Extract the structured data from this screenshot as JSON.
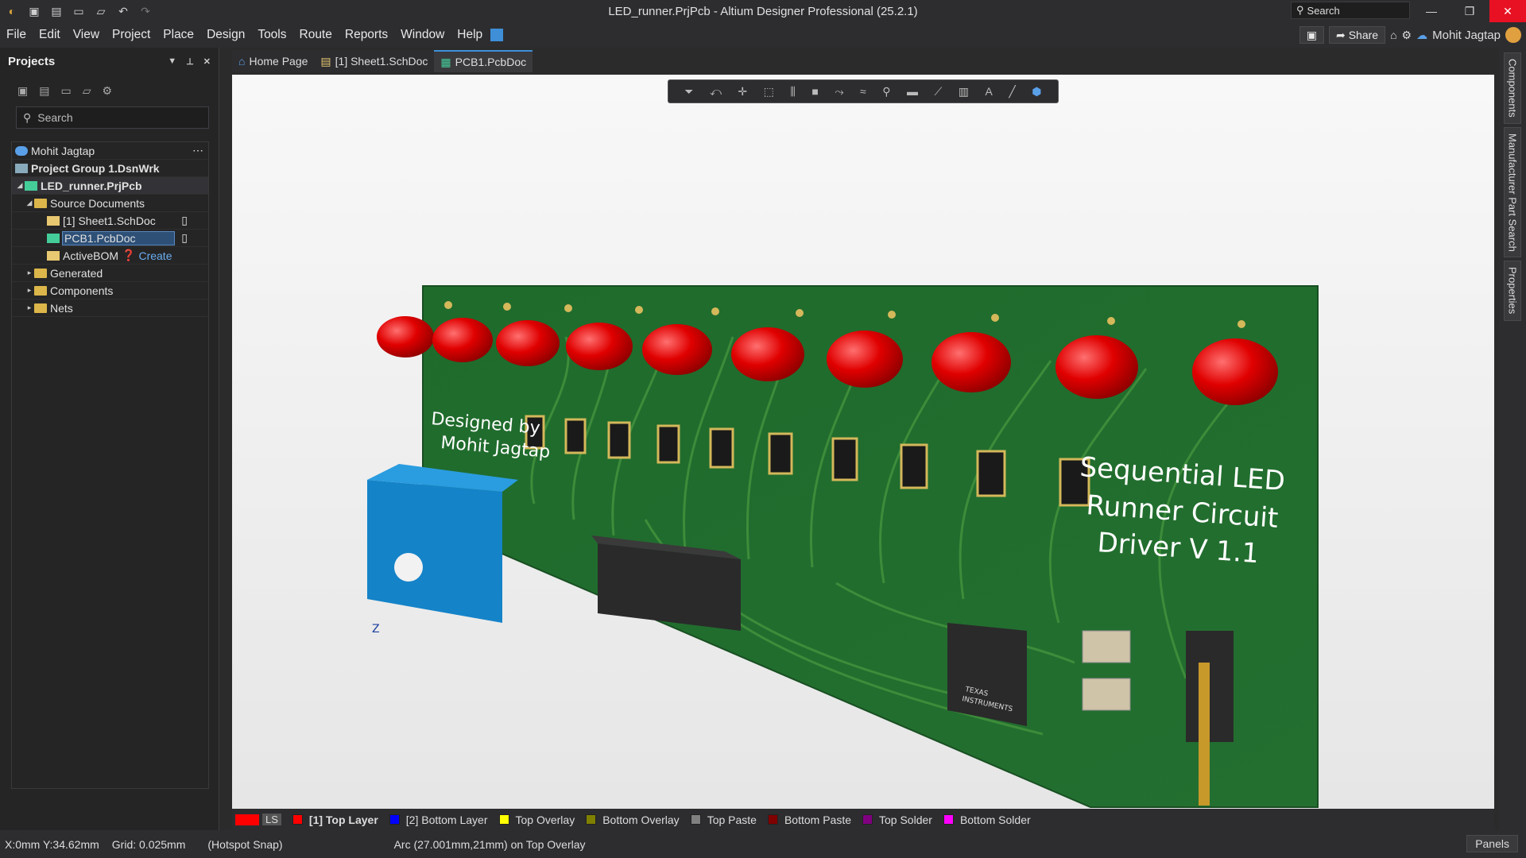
{
  "window": {
    "title": "LED_runner.PrjPcb - Altium Designer Professional (25.2.1)",
    "search_placeholder": "Search"
  },
  "menu": [
    "File",
    "Edit",
    "View",
    "Project",
    "Place",
    "Design",
    "Tools",
    "Route",
    "Reports",
    "Window",
    "Help"
  ],
  "menu_right": {
    "share": "Share",
    "user": "Mohit Jagtap"
  },
  "projects_panel": {
    "title": "Projects",
    "search_placeholder": "Search",
    "user": "Mohit Jagtap",
    "group": "Project Group 1.DsnWrk",
    "project": "LED_runner.PrjPcb",
    "source_docs": "Source Documents",
    "sheet": "[1] Sheet1.SchDoc",
    "pcb": "PCB1.PcbDoc",
    "bom": "ActiveBOM",
    "bom_create": "Create",
    "generated": "Generated",
    "components": "Components",
    "nets": "Nets"
  },
  "tabs": [
    {
      "label": "Home Page"
    },
    {
      "label": "[1] Sheet1.SchDoc"
    },
    {
      "label": "PCB1.PcbDoc"
    }
  ],
  "right_tabs": [
    "Components",
    "Manufacturer Part Search",
    "Properties"
  ],
  "board": {
    "silk_designed": "Designed by",
    "silk_name": "Mohit Jagtap",
    "silk_title1": "Sequential LED",
    "silk_title2": "Runner Circuit",
    "silk_title3": "Driver V 1.1",
    "ic_brand1": "TEXAS",
    "ic_brand2": "INSTRUMENTS",
    "axis": "Z"
  },
  "layers": {
    "ls": "LS",
    "items": [
      {
        "name": "[1] Top Layer",
        "color": "#ff0000",
        "active": true
      },
      {
        "name": "[2] Bottom Layer",
        "color": "#0000ff"
      },
      {
        "name": "Top Overlay",
        "color": "#ffff00"
      },
      {
        "name": "Bottom Overlay",
        "color": "#808000"
      },
      {
        "name": "Top Paste",
        "color": "#808080"
      },
      {
        "name": "Bottom Paste",
        "color": "#800000"
      },
      {
        "name": "Top Solder",
        "color": "#800080"
      },
      {
        "name": "Bottom Solder",
        "color": "#ff00ff"
      }
    ]
  },
  "status": {
    "coords": "X:0mm Y:34.62mm",
    "grid": "Grid: 0.025mm",
    "snap": "(Hotspot Snap)",
    "info": "Arc (27.001mm,21mm) on Top Overlay",
    "panels": "Panels"
  }
}
